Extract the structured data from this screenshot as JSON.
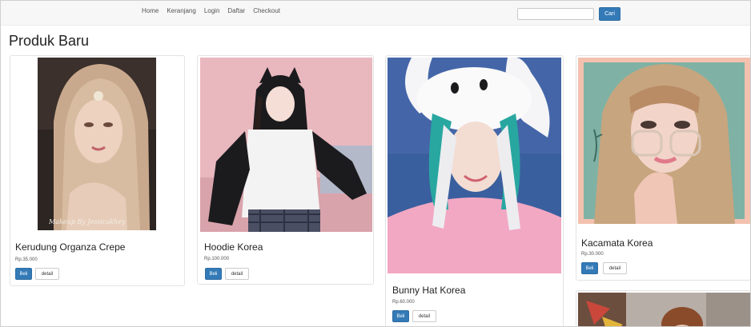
{
  "navbar": {
    "links": [
      "Home",
      "Keranjang",
      "Login",
      "Daftar",
      "Checkout"
    ],
    "search_placeholder": "",
    "search_button": "Cari"
  },
  "page": {
    "title": "Produk Baru"
  },
  "products": [
    {
      "name": "Kerudung Organza Crepe",
      "price": "Rp.35.000",
      "buy_label": "Beli",
      "detail_label": "detail",
      "image_caption": "Makeup By Jessicakhey"
    },
    {
      "name": "Hoodie Korea",
      "price": "Rp.100.000",
      "buy_label": "Beli",
      "detail_label": "detail"
    },
    {
      "name": "Bunny Hat Korea",
      "price": "Rp.60.000",
      "buy_label": "Beli",
      "detail_label": "detail"
    },
    {
      "name": "Kacamata Korea",
      "price": "Rp.30.000",
      "buy_label": "Beli",
      "detail_label": "detail"
    }
  ],
  "colors": {
    "primary": "#337ab7",
    "navbar_bg": "#f7f7f7",
    "card_border": "#e3e3e3"
  }
}
